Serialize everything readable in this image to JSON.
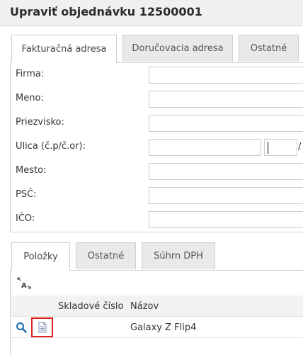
{
  "window": {
    "title": "Upraviť objednávku 12500001"
  },
  "address_tabs": [
    {
      "label": "Fakturačná adresa",
      "active": true
    },
    {
      "label": "Doručovacia adresa",
      "active": false
    },
    {
      "label": "Ostatné",
      "active": false
    }
  ],
  "address_form": {
    "firma": {
      "label": "Firma:",
      "value": ""
    },
    "meno": {
      "label": "Meno:",
      "value": ""
    },
    "priezvisko": {
      "label": "Priezvisko:",
      "value": ""
    },
    "ulica": {
      "label": "Ulica (č.p/č.or):",
      "street_value": "",
      "number_value": "",
      "separator": "/"
    },
    "mesto": {
      "label": "Mesto:",
      "value": ""
    },
    "psc": {
      "label": "PSČ:",
      "value": ""
    },
    "ico": {
      "label": "IČO:",
      "value": ""
    }
  },
  "items_tabs": [
    {
      "label": "Položky",
      "active": true
    },
    {
      "label": "Ostatné",
      "active": false
    },
    {
      "label": "Súhrn DPH",
      "active": false
    }
  ],
  "toolbar": {
    "icon": "autofit-columns-icon"
  },
  "items_grid": {
    "columns": [
      "Skladové číslo",
      "Názov"
    ],
    "rows": [
      {
        "sku": "",
        "name": "Galaxy Z Flip4",
        "actions": [
          "search-icon",
          "document-icon"
        ]
      }
    ]
  },
  "colors": {
    "highlight": "#e02020",
    "search_icon": "#1a6aa8"
  }
}
